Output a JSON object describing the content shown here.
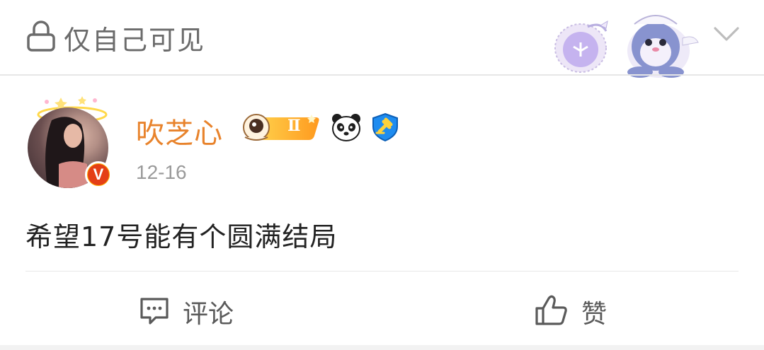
{
  "header": {
    "privacy_label": "仅自己可见",
    "lock_icon": "lock-icon",
    "decoration": "cartoon-sticker",
    "expand_icon": "chevron-down-icon"
  },
  "post": {
    "author": {
      "name": "吹芝心",
      "verified_badge": "V",
      "badges": [
        "astronaut-level-badge",
        "panda-badge",
        "shield-badge"
      ],
      "level_text": "Ⅱ"
    },
    "timestamp": "12-16",
    "text": "希望17号能有个圆满结局"
  },
  "actions": {
    "comment_label": "评论",
    "like_label": "赞"
  },
  "colors": {
    "username": "#e8832c",
    "muted": "#9a9a9a",
    "text": "#222222",
    "divider": "#e6e6e6",
    "verified": "#e43f16",
    "verified_ring": "#ffa800"
  }
}
